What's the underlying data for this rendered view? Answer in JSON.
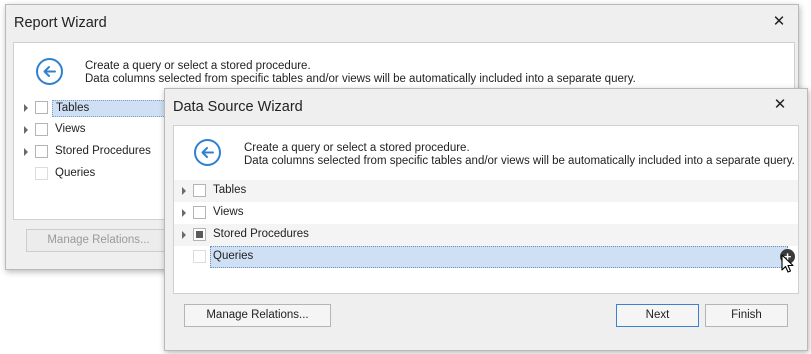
{
  "back_dialog": {
    "title": "Report Wizard",
    "close_glyph": "✕",
    "hint_line1": "Create a query or select a stored procedure.",
    "hint_line2": "Data columns selected from specific tables and/or views will be automatically included into a separate query.",
    "tree": [
      {
        "label": "Tables",
        "expandable": true,
        "checked": false,
        "selected": true
      },
      {
        "label": "Views",
        "expandable": true,
        "checked": false,
        "selected": false
      },
      {
        "label": "Stored Procedures",
        "expandable": true,
        "checked": false,
        "selected": false
      },
      {
        "label": "Queries",
        "expandable": false,
        "checked": false,
        "selected": false
      }
    ],
    "manage_relations_label": "Manage Relations..."
  },
  "front_dialog": {
    "title": "Data Source Wizard",
    "close_glyph": "✕",
    "hint_line1": "Create a query or select a stored procedure.",
    "hint_line2": "Data columns selected from specific tables and/or views will be automatically included into a separate query.",
    "tree": [
      {
        "label": "Tables",
        "expandable": true,
        "checked": false
      },
      {
        "label": "Views",
        "expandable": true,
        "checked": false
      },
      {
        "label": "Stored Procedures",
        "expandable": true,
        "checked": "indeterminate"
      },
      {
        "label": "Queries",
        "expandable": false,
        "checked": false,
        "selected": true
      }
    ],
    "add_query_glyph": "+",
    "manage_relations_label": "Manage Relations...",
    "next_label": "Next",
    "finish_label": "Finish"
  },
  "icons": {
    "back": "arrow-left-circle-icon",
    "expander": "triangle-right-icon",
    "add": "plus-circle-icon",
    "cursor": "mouse-pointer-icon"
  },
  "colors": {
    "accent": "#2f80cf",
    "selection": "#cfe0f4",
    "window_bg": "#efefef"
  }
}
